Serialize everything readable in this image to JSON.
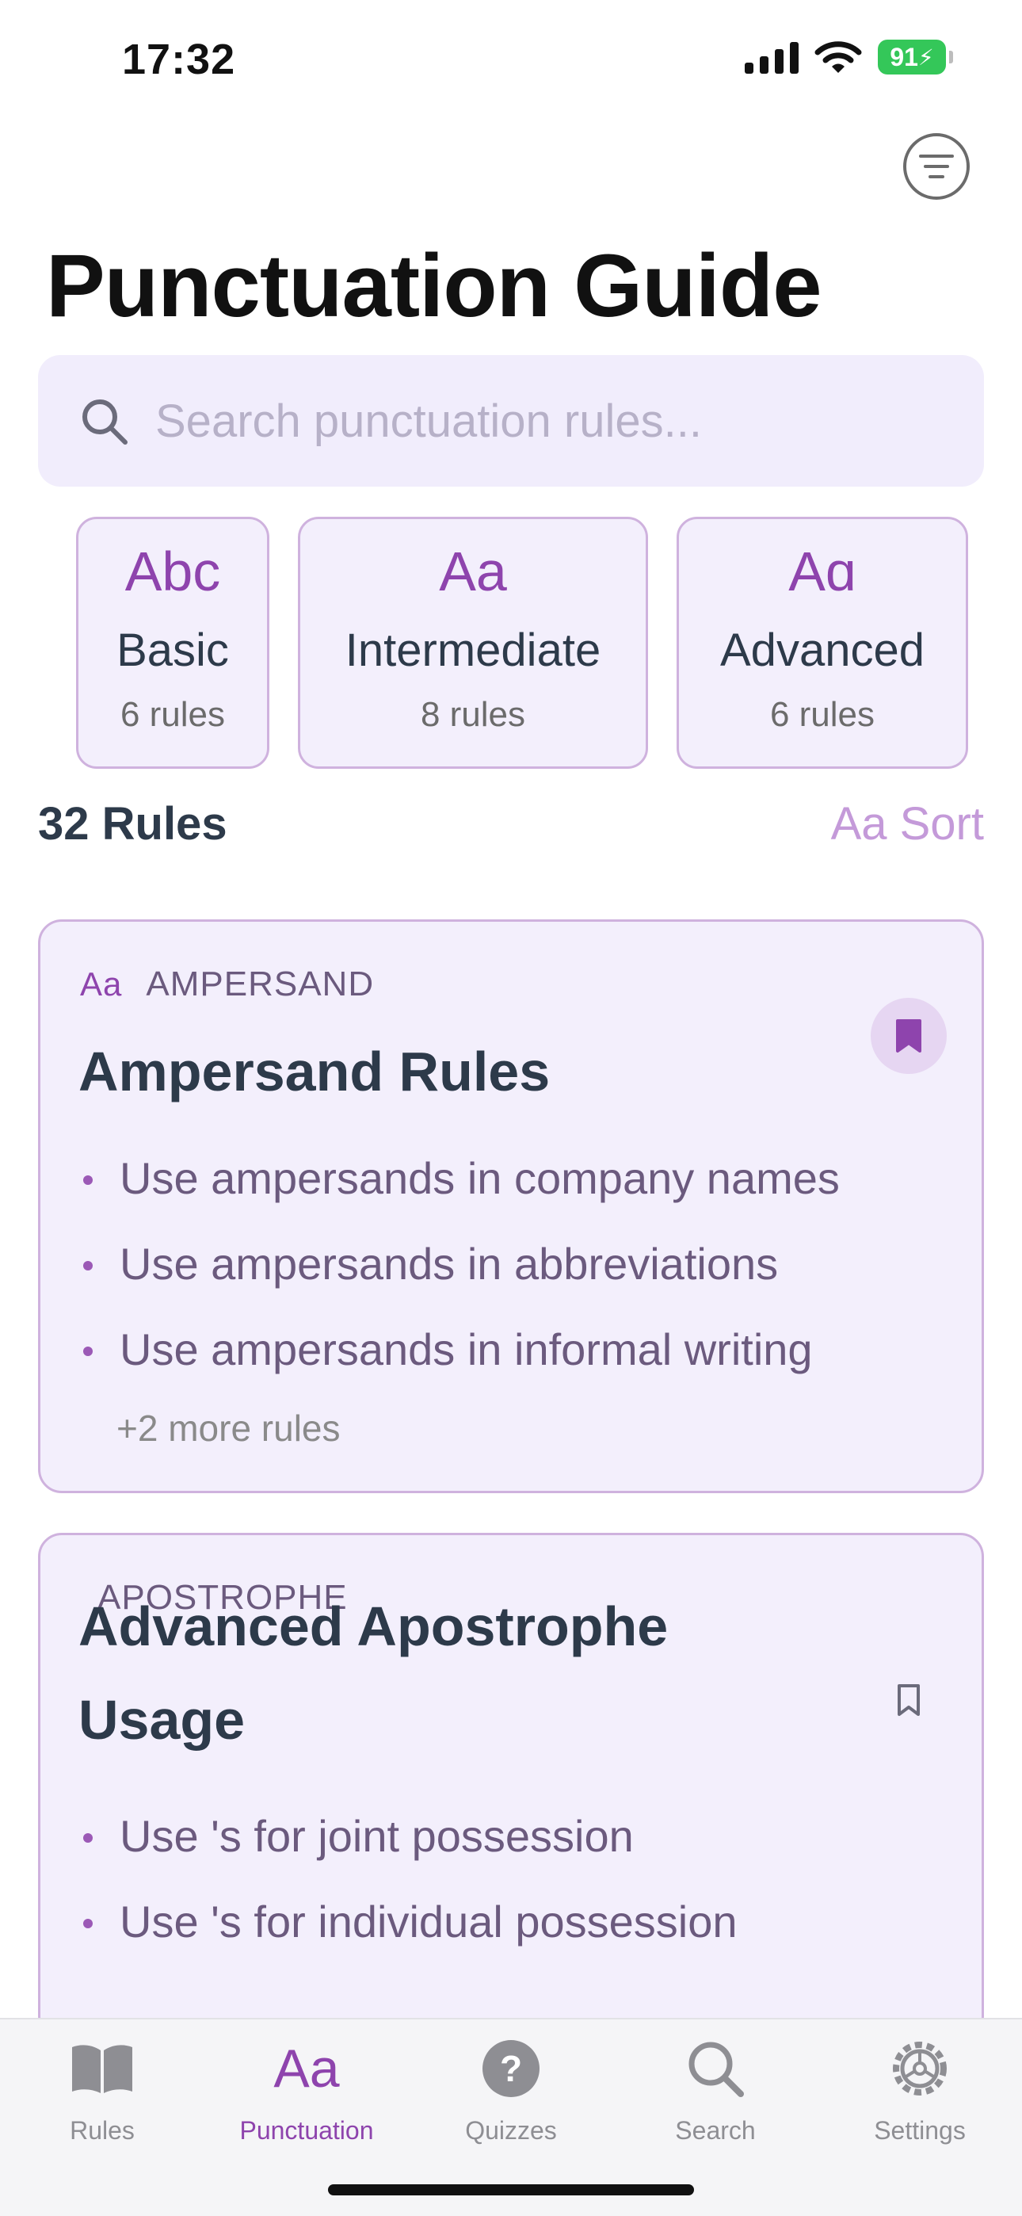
{
  "status_bar": {
    "time": "17:32",
    "battery": "91"
  },
  "header": {
    "title": "Punctuation Guide",
    "filter_icon": "filter-lines-icon"
  },
  "search": {
    "placeholder": "Search punctuation rules..."
  },
  "levels": [
    {
      "icon": "Abc",
      "name": "Basic",
      "count": "6 rules"
    },
    {
      "icon": "Aa",
      "name": "Intermediate",
      "count": "8 rules"
    },
    {
      "icon": "Aɑ",
      "name": "Advanced",
      "count": "6 rules"
    }
  ],
  "summary": {
    "count_label": "32 Rules",
    "sort_label": "Aa Sort"
  },
  "cards": [
    {
      "category_icon": "Aa",
      "category": "AMPERSAND",
      "title": "Ampersand Rules",
      "bookmarked": true,
      "rules": [
        "Use ampersands in company names",
        "Use ampersands in abbreviations",
        "Use ampersands in informal writing"
      ],
      "more": "+2 more rules"
    },
    {
      "category": "APOSTROPHE",
      "title_line1": "Advanced Apostrophe",
      "title_line2": "Usage",
      "bookmarked": false,
      "rules": [
        "Use 's for joint possession",
        "Use 's for individual possession"
      ]
    }
  ],
  "tabs": [
    {
      "label": "Rules",
      "icon": "book-icon",
      "active": false
    },
    {
      "label": "Punctuation",
      "icon": "Aa",
      "active": true
    },
    {
      "label": "Quizzes",
      "icon": "question-circle-icon",
      "active": false
    },
    {
      "label": "Search",
      "icon": "magnifier-icon",
      "active": false
    },
    {
      "label": "Settings",
      "icon": "gear-icon",
      "active": false
    }
  ],
  "colors": {
    "accent": "#8e44ad",
    "card_bg": "#f3effc",
    "card_border": "#cfb2de",
    "search_bg": "#f1edfc",
    "battery": "#34c759"
  }
}
